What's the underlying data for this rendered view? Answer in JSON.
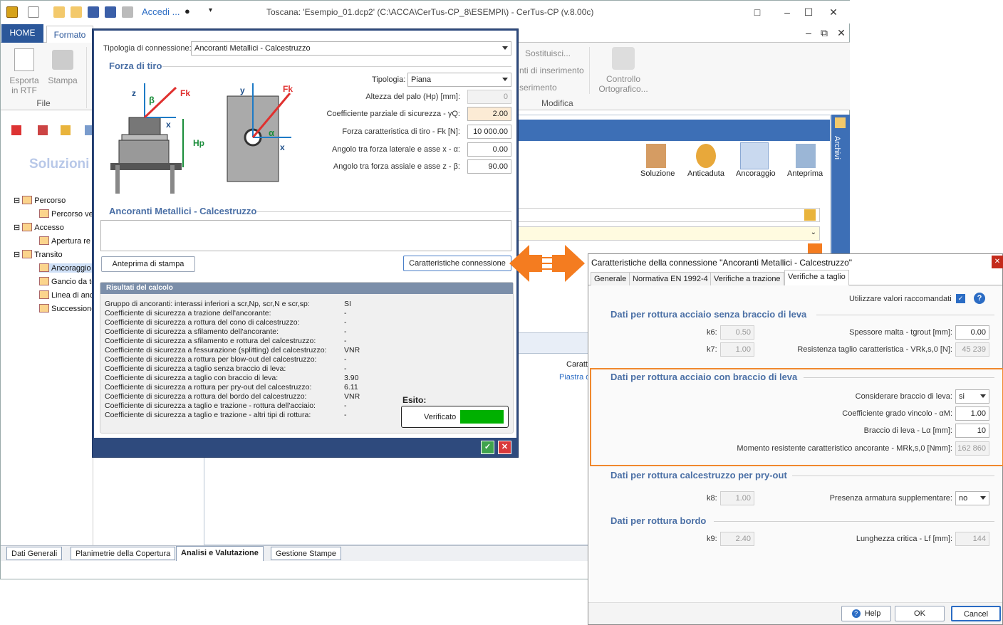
{
  "window": {
    "title": "Toscana: 'Esempio_01.dcp2'   (C:\\ACCA\\CerTus-CP_8\\ESEMPI\\) - CerTus-CP (v.8.00c)",
    "accedi": "Accedi ...",
    "tabs": {
      "home": "HOME",
      "formato": "Formato"
    },
    "ribbon": {
      "esporta": "Esporta in RTF",
      "stampa": "Stampa",
      "file_group": "File",
      "sostituisci": "Sostituisci...",
      "punti_inserimento": "nti di inserimento",
      "inserimento": "serimento",
      "modifica_group": "Modifica",
      "controllo": "Controllo Ortografico..."
    },
    "left_title": "Soluzioni",
    "tree": [
      "Percorso",
      "Percorso ve",
      "Accesso",
      "Apertura re",
      "Transito",
      "Ancoraggio",
      "Gancio da te",
      "Linea di anc",
      "Successione"
    ],
    "toolbar_right": [
      "Soluzione",
      "Anticaduta",
      "Ancoraggio",
      "Anteprima"
    ],
    "archivi": "Archivi",
    "grid_head": "Caratt",
    "grid_cell": "Piastra d",
    "bottom_tabs": [
      "Dati Generali",
      "Planimetrie della Copertura",
      "Analisi e Valutazione",
      "Gestione Stampe"
    ]
  },
  "dialog1": {
    "tipologia_connessione_label": "Tipologia di connessione:",
    "tipologia_connessione_value": "Ancoranti Metallici - Calcestruzzo",
    "forza_tiro_title": "Forza di tiro",
    "fields": [
      {
        "label": "Tipologia:",
        "value": "Piana",
        "kind": "combo"
      },
      {
        "label": "Altezza del palo (Hp) [mm]:",
        "value": "0",
        "kind": "disabled"
      },
      {
        "label": "Coefficiente parziale di sicurezza - γQ:",
        "value": "2.00",
        "kind": "peach"
      },
      {
        "label": "Forza caratteristica di tiro - Fk [N]:",
        "value": "10 000.00",
        "kind": "normal"
      },
      {
        "label": "Angolo tra forza laterale e asse x - α:",
        "value": "0.00",
        "kind": "normal"
      },
      {
        "label": "Angolo tra forza assiale e asse z - β:",
        "value": "90.00",
        "kind": "normal"
      }
    ],
    "ancoranti_title": "Ancoranti Metallici - Calcestruzzo",
    "btn_anteprima": "Anteprima di stampa",
    "btn_caratteristiche": "Caratteristiche connessione",
    "results_title": "Risultati del calcolo",
    "results": [
      {
        "label": "Gruppo di ancoranti: interassi inferiori a scr,Np, scr,N e scr,sp:",
        "value": "SI"
      },
      {
        "label": "Coefficiente di sicurezza a trazione dell'ancorante:",
        "value": "-"
      },
      {
        "label": "Coefficiente di sicurezza a rottura del cono di calcestruzzo:",
        "value": "-"
      },
      {
        "label": "Coefficiente di sicurezza a sfilamento dell'ancorante:",
        "value": "-"
      },
      {
        "label": "Coefficiente di sicurezza a sfilamento e rottura del calcestruzzo:",
        "value": "-"
      },
      {
        "label": "Coefficiente di sicurezza a fessurazione (splitting) del calcestruzzo:",
        "value": "VNR"
      },
      {
        "label": "Coefficiente di sicurezza a rottura per blow-out del calcestruzzo:",
        "value": "-"
      },
      {
        "label": "Coefficiente di sicurezza a taglio senza braccio di leva:",
        "value": "-"
      },
      {
        "label": "Coefficiente di sicurezza a taglio con braccio di leva:",
        "value": "3.90"
      },
      {
        "label": "Coefficiente di sicurezza a rottura per pry-out del calcestruzzo:",
        "value": "6.11"
      },
      {
        "label": "Coefficiente di sicurezza a rottura del bordo del calcestruzzo:",
        "value": "VNR"
      },
      {
        "label": "Coefficiente di sicurezza a taglio e trazione - rottura dell'acciaio:",
        "value": "-"
      },
      {
        "label": "Coefficiente di sicurezza a taglio e trazione - altri tipi di rottura:",
        "value": "-"
      }
    ],
    "esito_label": "Esito:",
    "esito_value": "Verificato",
    "esito_color": "#00b000"
  },
  "dialog2": {
    "title": "Caratteristiche della connessione  \"Ancoranti Metallici - Calcestruzzo\"",
    "tabs": [
      "Generale",
      "Normativa EN 1992-4",
      "Verifiche a trazione",
      "Verifiche a taglio"
    ],
    "utilizzare": "Utilizzare valori raccomandati",
    "sec1": "Dati per rottura acciaio senza braccio di leva",
    "k6_label": "k6:",
    "k6": "0.50",
    "k7_label": "k7:",
    "k7": "1.00",
    "spessore_label": "Spessore malta - tgrout [mm]:",
    "spessore": "0.00",
    "resistenza_label": "Resistenza taglio caratteristica - VRk,s,0 [N]:",
    "resistenza": "45 239",
    "sec2": "Dati per rottura acciaio con braccio di leva",
    "considerare_label": "Considerare braccio di leva:",
    "considerare": "si",
    "coeff_label": "Coefficiente grado vincolo - αM:",
    "coeff": "1.00",
    "braccio_label": "Braccio di leva - Lα [mm]:",
    "braccio": "10",
    "momento_label": "Momento resistente caratteristico ancorante - MRk,s,0 [Nmm]:",
    "momento": "162 860",
    "sec3": "Dati per rottura calcestruzzo per pry-out",
    "k8_label": "k8:",
    "k8": "1.00",
    "presenza_label": "Presenza armatura supplementare:",
    "presenza": "no",
    "sec4": "Dati per rottura bordo",
    "k9_label": "k9:",
    "k9": "2.40",
    "lunghezza_label": "Lunghezza critica - Lf [mm]:",
    "lunghezza": "144",
    "help": "Help",
    "ok": "OK",
    "cancel": "Cancel",
    "highlight_color": "#f0882d"
  },
  "figure": {
    "fk": "Fk",
    "beta": "β",
    "alpha": "α",
    "hp": "Hp",
    "x": "x",
    "y": "y",
    "z": "z"
  }
}
